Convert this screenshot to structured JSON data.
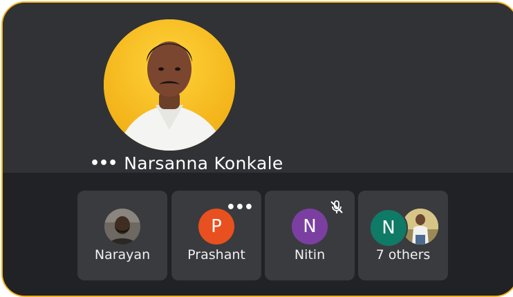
{
  "active_speaker": {
    "name": "Narsanna Konkale",
    "menu_glyph": "•••"
  },
  "participants": [
    {
      "name": "Narayan",
      "type": "photo",
      "more_glyph": ""
    },
    {
      "name": "Prashant",
      "initial": "P",
      "color": "#e8501f",
      "more_glyph": "•••"
    },
    {
      "name": "Nitin",
      "initial": "N",
      "color": "#7b3fa2",
      "muted": true
    },
    {
      "name": "7 others",
      "initial": "N",
      "color": "#0f7a65"
    }
  ],
  "colors": {
    "accent_border": "#f2b21a",
    "speaker_bg": "#313236",
    "strip_bg": "#212226",
    "tile_bg": "#3a3b3f"
  },
  "icons": [
    "more-icon",
    "mic-off-icon"
  ]
}
